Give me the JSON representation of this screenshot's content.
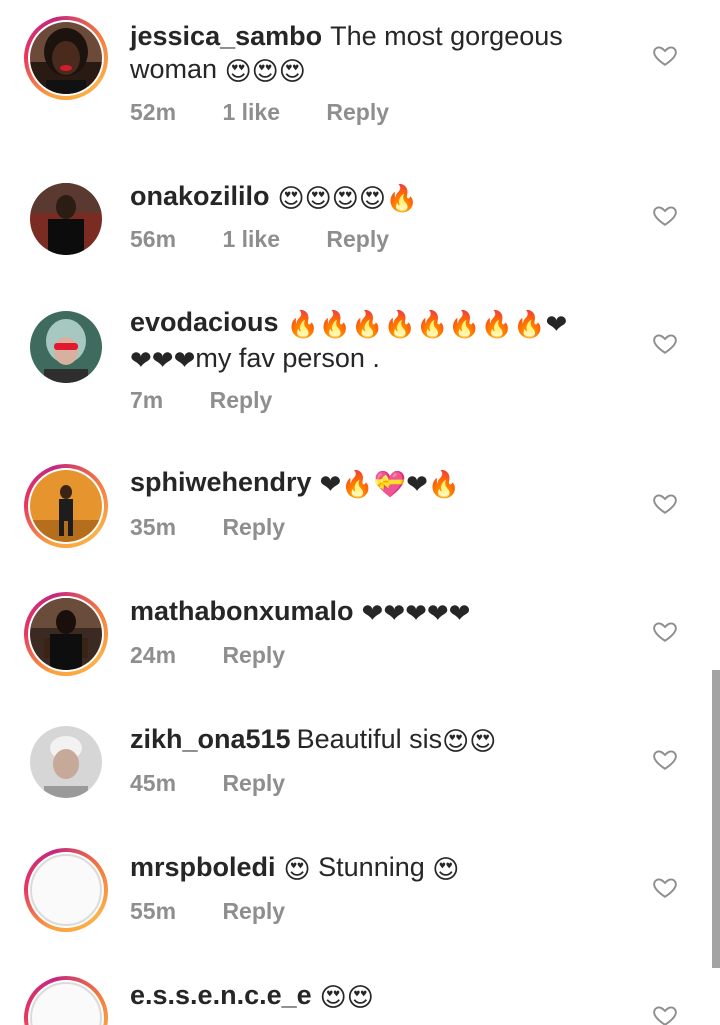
{
  "comments": [
    {
      "username": "jessica_sambo",
      "text_line1": "The most gorgeous",
      "text_line2": "woman",
      "emojis_line2": "😍😍😍",
      "time": "52m",
      "likes": "1 like",
      "reply": "Reply"
    },
    {
      "username": "onakozililo",
      "emojis": "😍😍😍😍🔥",
      "time": "56m",
      "likes": "1 like",
      "reply": "Reply"
    },
    {
      "username": "evodacious",
      "emojis_line1": "🔥🔥🔥🔥🔥🔥🔥🔥❤",
      "emojis_line2": "❤❤❤",
      "text_line2": "my fav person .",
      "time": "7m",
      "reply": "Reply"
    },
    {
      "username": "sphiwehendry",
      "emojis": "❤🔥💝❤🔥",
      "time": "35m",
      "reply": "Reply"
    },
    {
      "username": "mathabonxumalo",
      "emojis": "❤❤❤❤❤",
      "time": "24m",
      "reply": "Reply"
    },
    {
      "username": "zikh_ona515",
      "text": "Beautiful sis",
      "emojis": "😍😍",
      "time": "45m",
      "reply": "Reply"
    },
    {
      "username": "mrspboledi",
      "emoji_before": "😍",
      "text": "Stunning",
      "emoji_after": "😍",
      "time": "55m",
      "reply": "Reply"
    },
    {
      "username": "e.s.s.e.n.c.e_e",
      "emojis": "😍😍"
    }
  ],
  "icons": {
    "like": "heart-outline-icon"
  },
  "colors": {
    "story_ring": "#e8365f",
    "meta": "#8e8e8e",
    "text": "#262626",
    "heart_red": "#e0192f",
    "fire": "#f58a07"
  }
}
